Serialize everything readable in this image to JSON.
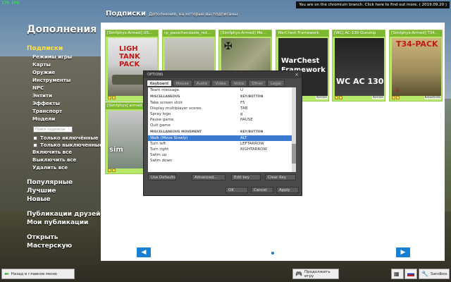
{
  "hud": {
    "fps": "170 FPS",
    "branch_notice": "You are on the chromium branch. Click here to find out more. ( 2019.09.20 )"
  },
  "left_menu": {
    "title": "Дополнения",
    "subscriptions": "Подписки",
    "categories": [
      "Режимы игры",
      "Карты",
      "Оружие",
      "Инструменты",
      "NPC",
      "Энтити",
      "Эффекты",
      "Транспорт",
      "Модели"
    ],
    "search_placeholder": "Поиск подписок",
    "filters": [
      "Только включённые",
      "Только выключенные"
    ],
    "actions": [
      "Включить все",
      "Выключить все",
      "Удалить все"
    ],
    "browse": [
      "Популярные",
      "Лучшие",
      "Новые"
    ],
    "social": [
      "Публикации друзей",
      "Мои публикации"
    ],
    "workshop": "Открыть Мастерскую"
  },
  "content": {
    "title": "Подписки",
    "subtitle": "Дополнения, на которые вы подписаны",
    "cards": [
      {
        "title": "[Simfphys-Armed] US...",
        "author": "Katz",
        "image": "tank-light-pack"
      },
      {
        "title": "rp_passchendaele_red...",
        "author": "",
        "image": "field-map"
      },
      {
        "title": "[Simfphys-Armed] Me...",
        "author": "",
        "image": "armed-vehicle"
      },
      {
        "title": "WarChest Framework",
        "author": "Kenzie",
        "image": "warchest"
      },
      {
        "title": "[WC] AC-130 Gunship",
        "author": "Kenzie",
        "image": "ac130"
      },
      {
        "title": "[Simfphys-Armed] T34...",
        "author": "Kelastrofa",
        "image": "t34-pack"
      },
      {
        "title": "[Simfphys] armed ve...",
        "author": "",
        "image": "sim-vehicle"
      }
    ],
    "card_texts": {
      "tank": "LIGH TANK PACK",
      "warchest": "WarChest Framework",
      "ac130": "WC AC 130",
      "t34": "T34-PACK",
      "sim": "sim"
    }
  },
  "dialog": {
    "title": "OPTIONS",
    "tabs": [
      "Keyboard",
      "Mouse",
      "Audio",
      "Video",
      "Voice",
      "Other",
      "Legal"
    ],
    "active_tab": "Keyboard",
    "rows": [
      {
        "type": "row",
        "action": "Team message",
        "key": "U"
      },
      {
        "type": "section",
        "action": "MISCELLANEOUS",
        "key": "KEY/BUTTON"
      },
      {
        "type": "row",
        "action": "Take screen shot",
        "key": "F5"
      },
      {
        "type": "row",
        "action": "Display multiplayer scores",
        "key": "TAB"
      },
      {
        "type": "row",
        "action": "Spray logo",
        "key": "g"
      },
      {
        "type": "row",
        "action": "Pause game",
        "key": "PAUSE"
      },
      {
        "type": "row",
        "action": "Quit game",
        "key": ""
      },
      {
        "type": "section",
        "action": "MISCELLANEOUS MOVEMENT",
        "key": "KEY/BUTTON"
      },
      {
        "type": "sel",
        "action": "Walk (Move Slowly)",
        "key": "ALT"
      },
      {
        "type": "row",
        "action": "Turn left",
        "key": "LEFTARROW"
      },
      {
        "type": "row",
        "action": "Turn right",
        "key": "RIGHTARROW"
      },
      {
        "type": "row",
        "action": "Swim up",
        "key": ""
      },
      {
        "type": "row",
        "action": "Swim down",
        "key": ""
      }
    ],
    "buttons": {
      "use_defaults": "Use Defaults",
      "advanced": "Advanced...",
      "edit_key": "Edit key",
      "clear_key": "Clear Key",
      "ok": "OK",
      "cancel": "Cancel",
      "apply": "Apply"
    }
  },
  "bottom": {
    "back": "Назад в главное меню",
    "continue": "Продолжить игру",
    "gamemode": "Sandbox"
  }
}
